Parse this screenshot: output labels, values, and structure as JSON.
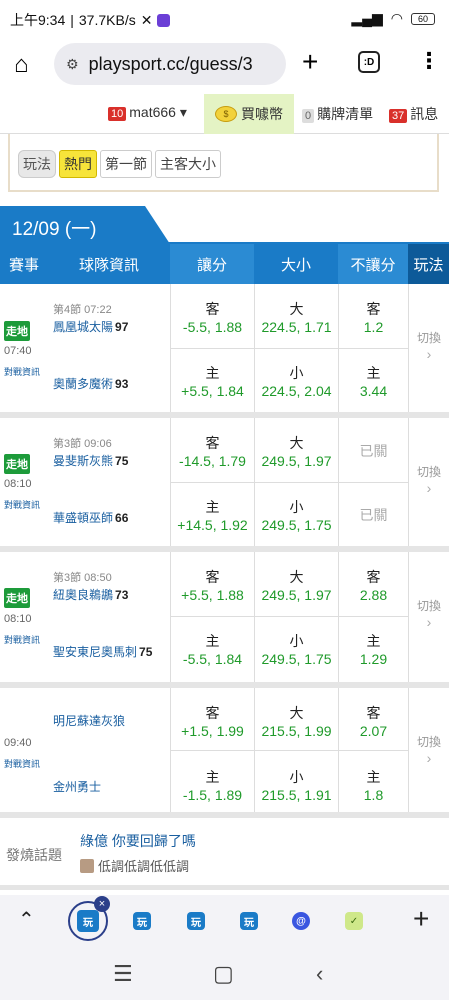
{
  "status_bar": {
    "time": "上午9:34",
    "speed": "37.7KB/s",
    "battery": "60"
  },
  "browser": {
    "url": "playsport.cc/guess/3",
    "tab_icon": ":D"
  },
  "user_bar": {
    "user_count": "10",
    "username": "mat666",
    "buy_label": "買噱幣",
    "cart_count": "0",
    "cart_label": "購牌清單",
    "msg_count": "37",
    "msg_label": "訊息"
  },
  "filters": {
    "label": "玩法",
    "items": [
      "熱門",
      "第一節",
      "主客大小"
    ],
    "active": "熱門"
  },
  "date_tab": "12/09 (一)",
  "headers": [
    "賽事",
    "球隊資訊",
    "讓分",
    "大小",
    "不讓分",
    "玩法"
  ],
  "games": [
    {
      "live": "走地",
      "time": "07:40",
      "analysis": "對戰資訊",
      "period": "第4節 07:22",
      "away": {
        "name": "鳳凰城太陽",
        "score": "97"
      },
      "home": {
        "name": "奧蘭多魔術",
        "score": "93"
      },
      "spread_away": {
        "side": "客",
        "value": "-5.5, 1.88"
      },
      "spread_home": {
        "side": "主",
        "value": "+5.5, 1.84"
      },
      "total_over": {
        "side": "大",
        "value": "224.5, 1.71"
      },
      "total_under": {
        "side": "小",
        "value": "224.5, 2.04"
      },
      "ml_away": {
        "side": "客",
        "value": "1.2"
      },
      "ml_home": {
        "side": "主",
        "value": "3.44"
      },
      "switch": "切換"
    },
    {
      "live": "走地",
      "time": "08:10",
      "analysis": "對戰資訊",
      "period": "第3節 09:06",
      "away": {
        "name": "曼斐斯灰熊",
        "score": "75"
      },
      "home": {
        "name": "華盛頓巫師",
        "score": "66"
      },
      "spread_away": {
        "side": "客",
        "value": "-14.5, 1.79"
      },
      "spread_home": {
        "side": "主",
        "value": "+14.5, 1.92"
      },
      "total_over": {
        "side": "大",
        "value": "249.5, 1.97"
      },
      "total_under": {
        "side": "小",
        "value": "249.5, 1.75"
      },
      "ml_away": {
        "closed": "已關"
      },
      "ml_home": {
        "closed": "已關"
      },
      "switch": "切換"
    },
    {
      "live": "走地",
      "time": "08:10",
      "analysis": "對戰資訊",
      "period": "第3節 08:50",
      "away": {
        "name": "紐奧良鵜鶘",
        "score": "73"
      },
      "home": {
        "name": "聖安東尼奧馬刺",
        "score": "75"
      },
      "spread_away": {
        "side": "客",
        "value": "+5.5, 1.88"
      },
      "spread_home": {
        "side": "主",
        "value": "-5.5, 1.84"
      },
      "total_over": {
        "side": "大",
        "value": "249.5, 1.97"
      },
      "total_under": {
        "side": "小",
        "value": "249.5, 1.75"
      },
      "ml_away": {
        "side": "客",
        "value": "2.88"
      },
      "ml_home": {
        "side": "主",
        "value": "1.29"
      },
      "switch": "切換"
    },
    {
      "live": "",
      "time": "09:40",
      "analysis": "對戰資訊",
      "period": "",
      "away": {
        "name": "明尼蘇達灰狼",
        "score": ""
      },
      "home": {
        "name": "金州勇士",
        "score": ""
      },
      "spread_away": {
        "side": "客",
        "value": "+1.5, 1.99"
      },
      "spread_home": {
        "side": "主",
        "value": "-1.5, 1.89"
      },
      "total_over": {
        "side": "大",
        "value": "215.5, 1.99"
      },
      "total_under": {
        "side": "小",
        "value": "215.5, 1.91"
      },
      "ml_away": {
        "side": "客",
        "value": "2.07"
      },
      "ml_home": {
        "side": "主",
        "value": "1.8"
      },
      "switch": "切換"
    }
  ],
  "hot_topic": {
    "label": "發燒話題",
    "title": "綠億 你要回歸了嗎",
    "author": "低調低調低低調"
  },
  "tab_icons": [
    "玩",
    "玩",
    "玩",
    "玩",
    "@",
    "✓"
  ],
  "colors": {
    "primary": "#1a7bc7",
    "odds_green": "#1f9a2a",
    "live_green": "#1d9b3a",
    "buy_bg": "#e4f3c4"
  }
}
